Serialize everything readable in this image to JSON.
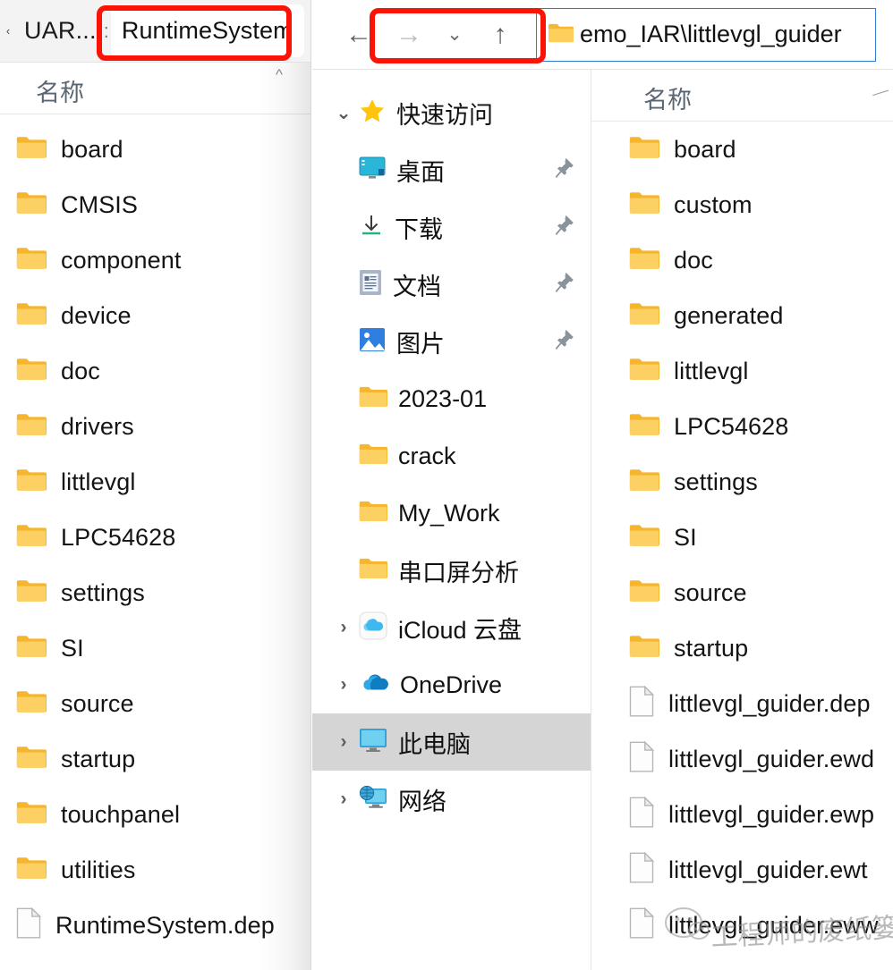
{
  "left_window": {
    "tabs": {
      "overflow_icon": "chevron-left-icon",
      "inactive_tab_label": "UAR...",
      "separator": ":",
      "active_tab_label": "RuntimeSystem"
    },
    "column_header": {
      "name_label": "名称",
      "sort_indicator": "chevron-up-icon"
    },
    "items": [
      {
        "name": "board",
        "type": "folder"
      },
      {
        "name": "CMSIS",
        "type": "folder"
      },
      {
        "name": "component",
        "type": "folder"
      },
      {
        "name": "device",
        "type": "folder"
      },
      {
        "name": "doc",
        "type": "folder"
      },
      {
        "name": "drivers",
        "type": "folder"
      },
      {
        "name": "littlevgl",
        "type": "folder"
      },
      {
        "name": "LPC54628",
        "type": "folder"
      },
      {
        "name": "settings",
        "type": "folder"
      },
      {
        "name": "SI",
        "type": "folder"
      },
      {
        "name": "source",
        "type": "folder"
      },
      {
        "name": "startup",
        "type": "folder"
      },
      {
        "name": "touchpanel",
        "type": "folder"
      },
      {
        "name": "utilities",
        "type": "folder"
      },
      {
        "name": "RuntimeSystem.dep",
        "type": "file"
      }
    ]
  },
  "right_window": {
    "toolbar": {
      "back_icon": "arrow-left-icon",
      "forward_icon": "arrow-right-icon",
      "recent_icon": "chevron-down-icon",
      "up_icon": "arrow-up-icon"
    },
    "address_bar": {
      "folder_icon": "folder-icon",
      "path_text": "emo_IAR\\littlevgl_guider",
      "dropdown_icon": "chevron-down-icon"
    },
    "tree": [
      {
        "label": "快速访问",
        "icon": "star-icon",
        "chevron": "chevron-down-icon",
        "level": 0,
        "selected": false,
        "pinned": false
      },
      {
        "label": "桌面",
        "icon": "desktop-icon",
        "chevron": "",
        "level": 1,
        "selected": false,
        "pinned": true
      },
      {
        "label": "下载",
        "icon": "download-icon",
        "chevron": "",
        "level": 1,
        "selected": false,
        "pinned": true
      },
      {
        "label": "文档",
        "icon": "document-icon",
        "chevron": "",
        "level": 1,
        "selected": false,
        "pinned": true
      },
      {
        "label": "图片",
        "icon": "pictures-icon",
        "chevron": "",
        "level": 1,
        "selected": false,
        "pinned": true
      },
      {
        "label": "2023-01",
        "icon": "folder-icon",
        "chevron": "",
        "level": 1,
        "selected": false,
        "pinned": false
      },
      {
        "label": "crack",
        "icon": "folder-icon",
        "chevron": "",
        "level": 1,
        "selected": false,
        "pinned": false
      },
      {
        "label": "My_Work",
        "icon": "folder-icon",
        "chevron": "",
        "level": 1,
        "selected": false,
        "pinned": false
      },
      {
        "label": "串口屏分析",
        "icon": "folder-icon",
        "chevron": "",
        "level": 1,
        "selected": false,
        "pinned": false
      },
      {
        "label": "iCloud 云盘",
        "icon": "icloud-icon",
        "chevron": "chevron-right-icon",
        "level": 0,
        "selected": false,
        "pinned": false
      },
      {
        "label": "OneDrive",
        "icon": "onedrive-icon",
        "chevron": "chevron-right-icon",
        "level": 0,
        "selected": false,
        "pinned": false
      },
      {
        "label": "此电脑",
        "icon": "this-pc-icon",
        "chevron": "chevron-right-icon",
        "level": 0,
        "selected": true,
        "pinned": false
      },
      {
        "label": "网络",
        "icon": "network-icon",
        "chevron": "chevron-right-icon",
        "level": 0,
        "selected": false,
        "pinned": false
      }
    ],
    "column_header": {
      "name_label": "名称"
    },
    "items": [
      {
        "name": "board",
        "type": "folder"
      },
      {
        "name": "custom",
        "type": "folder"
      },
      {
        "name": "doc",
        "type": "folder"
      },
      {
        "name": "generated",
        "type": "folder"
      },
      {
        "name": "littlevgl",
        "type": "folder"
      },
      {
        "name": "LPC54628",
        "type": "folder"
      },
      {
        "name": "settings",
        "type": "folder"
      },
      {
        "name": "SI",
        "type": "folder"
      },
      {
        "name": "source",
        "type": "folder"
      },
      {
        "name": "startup",
        "type": "folder"
      },
      {
        "name": "littlevgl_guider.dep",
        "type": "file"
      },
      {
        "name": "littlevgl_guider.ewd",
        "type": "file"
      },
      {
        "name": "littlevgl_guider.ewp",
        "type": "file"
      },
      {
        "name": "littlevgl_guider.ewt",
        "type": "file"
      },
      {
        "name": "littlevgl_guider.eww",
        "type": "file"
      }
    ]
  },
  "annotations": {
    "highlight_color": "#fb1406",
    "boxes": [
      {
        "target": "active tab RuntimeSystem"
      },
      {
        "target": "address path littlevgl_guider"
      }
    ]
  },
  "watermark": {
    "text": "工程师的废纸篓"
  }
}
